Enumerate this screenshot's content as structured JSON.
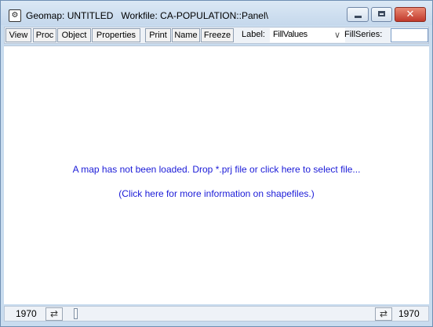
{
  "window": {
    "title": "Geomap: UNTITLED   Workfile: CA-POPULATION::Panel\\",
    "icon": "globe-icon",
    "controls": {
      "minimize_icon": "minimize-icon",
      "maximize_icon": "maximize-icon",
      "close_icon": "close-icon",
      "close_glyph": "✕"
    }
  },
  "toolbar": {
    "buttons": [
      "View",
      "Proc",
      "Object",
      "Properties",
      "Print",
      "Name",
      "Freeze"
    ],
    "label_caption": "Label:",
    "label_value": "FillValues",
    "fillseries_caption": "FillSeries:",
    "fillseries_value": ""
  },
  "canvas": {
    "message": "A map has not been loaded. Drop *.prj file or click here to select file...",
    "info_link": "(Click here for more information on shapefiles.)",
    "link_color": "#1b1bd8"
  },
  "status": {
    "start_year": "1970",
    "end_year": "1970",
    "swap_glyph": "⇄"
  },
  "colors": {
    "frame": "#c9dcef",
    "close": "#c1392b"
  }
}
